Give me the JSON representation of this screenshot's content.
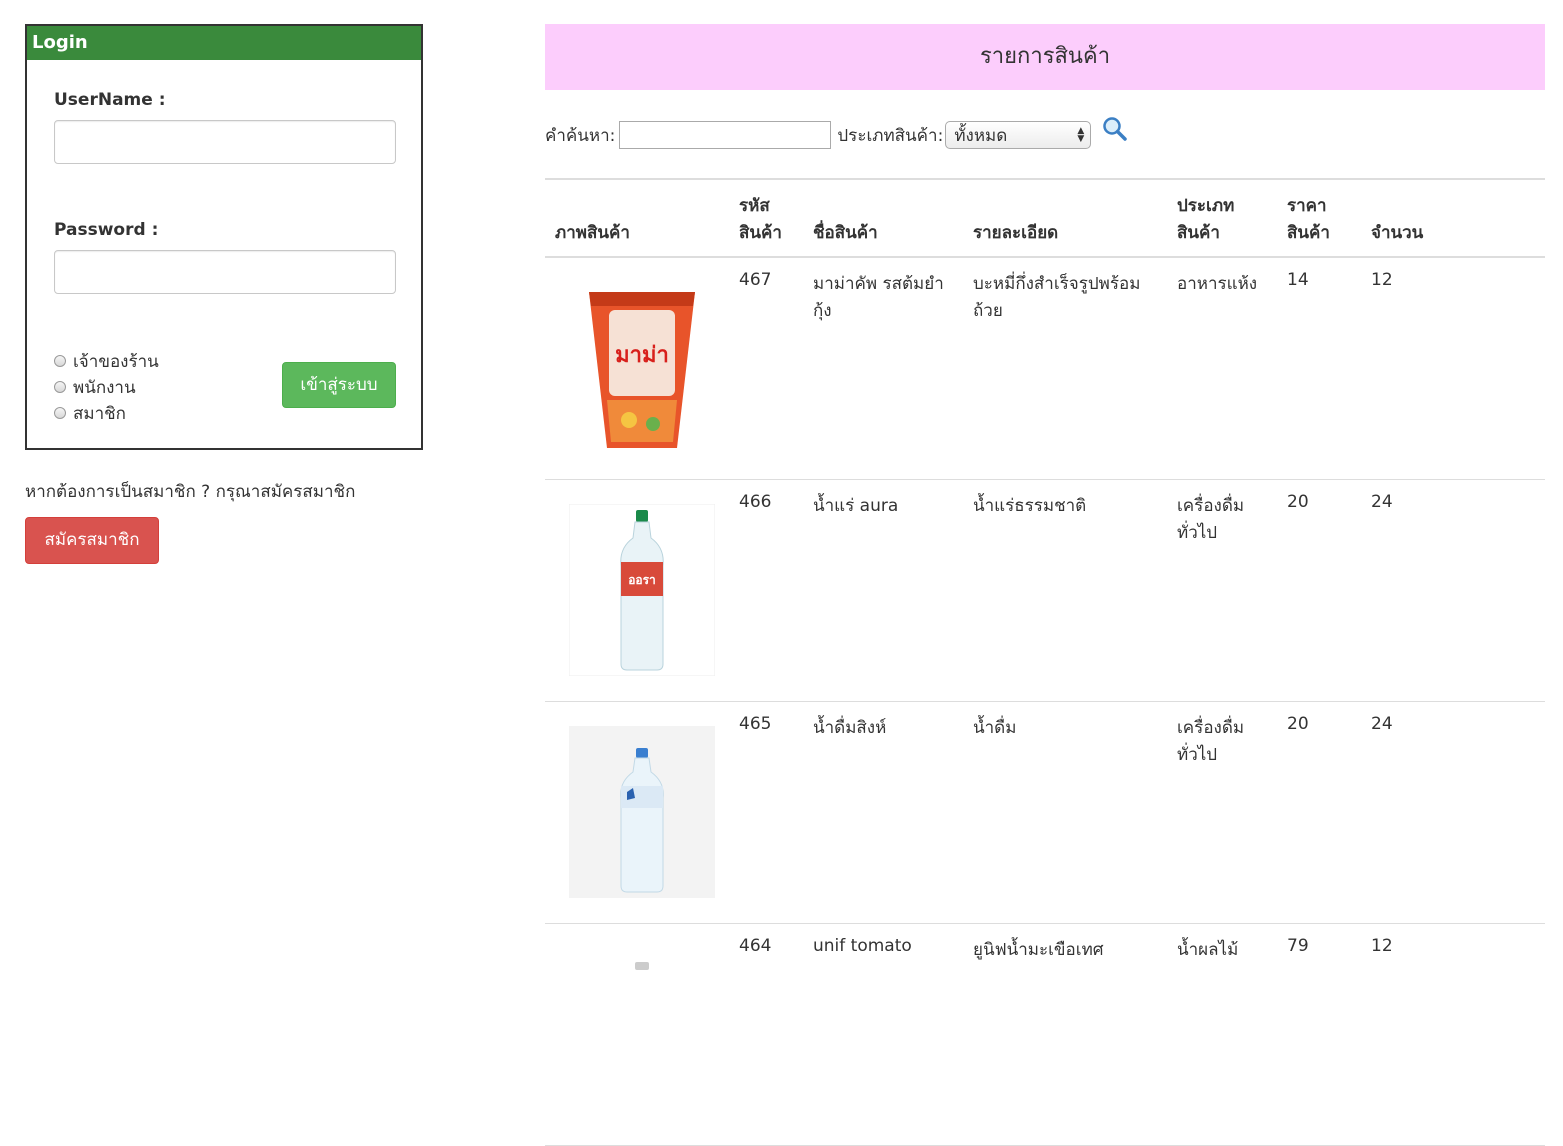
{
  "login": {
    "header": "Login",
    "username_label": "UserName :",
    "username_value": "",
    "password_label": "Password :",
    "password_value": "",
    "roles": [
      "เจ้าของร้าน",
      "พนักงาน",
      "สมาชิก"
    ],
    "submit_label": "เข้าสู่ระบบ"
  },
  "register": {
    "prompt": "หากต้องการเป็นสมาชิก ? กรุณาสมัครสมาชิก",
    "button_label": "สมัครสมาชิก"
  },
  "catalog": {
    "title": "รายการสินค้า",
    "search_label": "คำค้นหา:",
    "search_value": "",
    "category_label": "ประเภทสินค้า:",
    "category_selected": "ทั้งหมด",
    "columns": [
      "ภาพสินค้า",
      "รหัส สินค้า",
      "ชื่อสินค้า",
      "รายละเอียด",
      "ประเภทสินค้า",
      "ราคาสินค้า",
      "จำนวน"
    ],
    "rows": [
      {
        "id": "467",
        "name": "มาม่าคัพ รสต้มยำกุ้ง",
        "detail": "บะหมี่กึ่งสำเร็จรูปพร้อมถ้วย",
        "category": "อาหารแห้ง",
        "price": "14",
        "qty": "12",
        "image": "noodle-cup-image"
      },
      {
        "id": "466",
        "name": "น้ำแร่ aura",
        "detail": "น้ำแร่ธรรมชาติ",
        "category": "เครื่องดื่มทั่วไป",
        "price": "20",
        "qty": "24",
        "image": "water-bottle-image",
        "label": "ออรา"
      },
      {
        "id": "465",
        "name": "น้ำดื่มสิงห์",
        "detail": "น้ำดื่ม",
        "category": "เครื่องดื่มทั่วไป",
        "price": "20",
        "qty": "24",
        "image": "water-bottle-image"
      },
      {
        "id": "464",
        "name": "unif tomato",
        "detail": "ยูนิฟน้ำมะเขือเทศ",
        "category": "น้ำผลไม้",
        "price": "79",
        "qty": "12",
        "image": "juice-image"
      }
    ]
  },
  "colors": {
    "login_header": "#3a8a3c",
    "login_button": "#5cb85c",
    "register_button": "#d9534f",
    "title_bar": "#fccdfc"
  }
}
